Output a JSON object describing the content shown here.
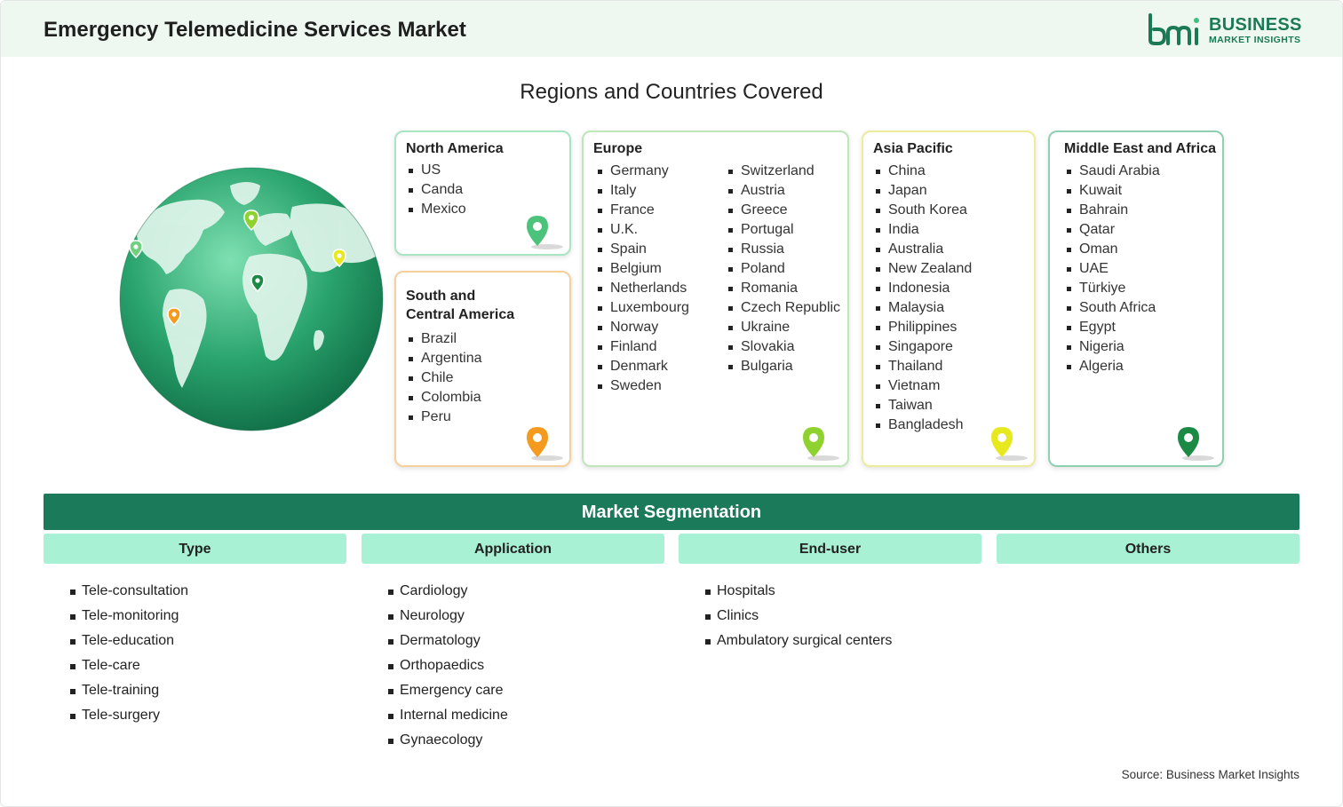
{
  "header": {
    "title": "Emergency Telemedicine Services Market",
    "logo_line1": "BUSINESS",
    "logo_line2": "MARKET INSIGHTS",
    "brand_color": "#1b7a55",
    "logo_icon": "bmi-logo-icon"
  },
  "regions_section": {
    "title": "Regions and Countries Covered",
    "globe_icon": "globe-icon",
    "regions": [
      {
        "name": "North America",
        "pin_color": "#4cc37a",
        "countries": [
          "US",
          "Canda",
          "Mexico"
        ]
      },
      {
        "name": "South and Central America",
        "name_lines": [
          "South and",
          "Central America"
        ],
        "pin_color": "#f39a1f",
        "countries": [
          "Brazil",
          "Argentina",
          "Chile",
          "Colombia",
          "Peru"
        ]
      },
      {
        "name": "Europe",
        "pin_color": "#8fd12e",
        "countries_col1": [
          "Germany",
          "Italy",
          "France",
          "U.K.",
          "Spain",
          "Belgium",
          "Netherlands",
          "Luxembourg",
          "Norway",
          "Finland",
          "Denmark",
          "Sweden"
        ],
        "countries_col2": [
          "Switzerland",
          "Austria",
          "Greece",
          "Portugal",
          "Russia",
          "Poland",
          "Romania",
          "Czech Republic",
          "Ukraine",
          "Slovakia",
          "Bulgaria"
        ]
      },
      {
        "name": "Asia Pacific",
        "pin_color": "#e8e81e",
        "countries": [
          "China",
          "Japan",
          "South Korea",
          "India",
          "Australia",
          "New Zealand",
          "Indonesia",
          "Malaysia",
          "Philippines",
          "Singapore",
          "Thailand",
          "Vietnam",
          "Taiwan",
          "Bangladesh"
        ]
      },
      {
        "name": "Middle East and Africa",
        "pin_color": "#1a8a45",
        "countries": [
          "Saudi Arabia",
          "Kuwait",
          "Bahrain",
          "Qatar",
          "Oman",
          "UAE",
          "Türkiye",
          "South Africa",
          "Egypt",
          "Nigeria",
          "Algeria"
        ]
      }
    ]
  },
  "segmentation": {
    "title": "Market Segmentation",
    "columns": [
      {
        "header": "Type",
        "items": [
          "Tele-consultation",
          "Tele-monitoring",
          "Tele-education",
          "Tele-care",
          "Tele-training",
          "Tele-surgery"
        ]
      },
      {
        "header": "Application",
        "items": [
          "Cardiology",
          "Neurology",
          "Dermatology",
          "Orthopaedics",
          "Emergency care",
          "Internal medicine",
          "Gynaecology"
        ]
      },
      {
        "header": "End-user",
        "items": [
          "Hospitals",
          "Clinics",
          "Ambulatory surgical centers"
        ]
      },
      {
        "header": "Others",
        "items": []
      }
    ]
  },
  "source": "Source: Business Market Insights"
}
